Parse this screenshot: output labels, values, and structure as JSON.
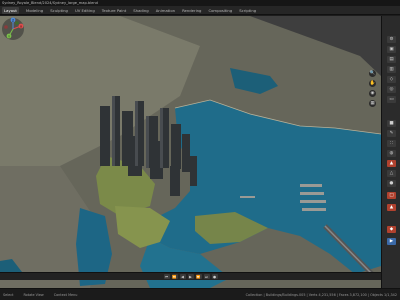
{
  "window": {
    "title": "Sydney_Royale_Blend/2024/Sydney_large_map.blend"
  },
  "menubar": {
    "items": [
      "Layout",
      "Modeling",
      "Sculpting",
      "UV Editing",
      "Texture Paint",
      "Shading",
      "Animation",
      "Rendering",
      "Compositing",
      "Scripting"
    ],
    "active": "Layout"
  },
  "status_bar": {
    "left": [
      "Select",
      "Rotate View",
      "Context Menu"
    ],
    "right": "Collection | Buildings/Buildings.005 | Verts 4,231,556 | Faces 3,872,100 | Objects 1/1,342"
  },
  "gizmo": {
    "x_label": "X",
    "y_label": "Y",
    "z_label": "Z"
  },
  "colors": {
    "accent": "#b0412e",
    "water": "#1f6c8a",
    "land": "#6b6c5c",
    "park": "#7c8d4a"
  },
  "icons": {
    "zoom": "magnifier",
    "pan": "hand",
    "camera": "camera",
    "grid": "grid"
  }
}
